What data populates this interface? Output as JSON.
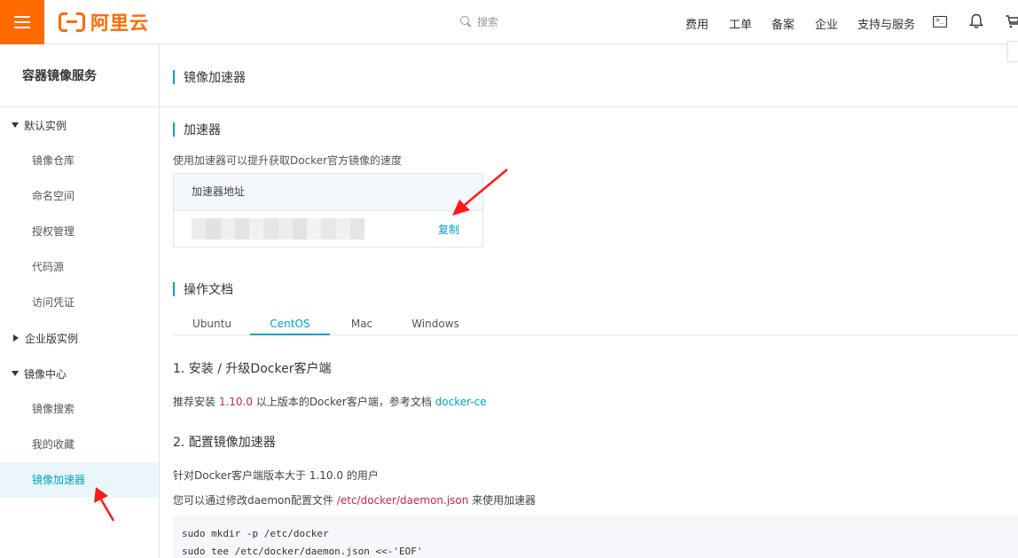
{
  "colors": {
    "brand": "#ff6a00",
    "accent": "#00a2ca",
    "arrow": "#ff1a1a",
    "code_red": "#c7254e"
  },
  "header": {
    "menu_icon": "hamburger-icon",
    "logo_text": "阿里云",
    "search_placeholder": "搜索",
    "nav": [
      "费用",
      "工单",
      "备案",
      "企业",
      "支持与服务"
    ],
    "icons": [
      "terminal-icon",
      "bell-icon",
      "cart-icon"
    ]
  },
  "sidebar": {
    "title": "容器镜像服务",
    "groups": [
      {
        "label": "默认实例",
        "expanded": true,
        "items": [
          "镜像仓库",
          "命名空间",
          "授权管理",
          "代码源",
          "访问凭证"
        ]
      },
      {
        "label": "企业版实例",
        "expanded": false,
        "items": []
      },
      {
        "label": "镜像中心",
        "expanded": true,
        "items": [
          "镜像搜索",
          "我的收藏",
          "镜像加速器"
        ]
      }
    ],
    "active_item": "镜像加速器"
  },
  "main": {
    "page_title": "镜像加速器",
    "accelerator": {
      "section_title": "加速器",
      "description": "使用加速器可以提升获取Docker官方镜像的速度",
      "box_header": "加速器地址",
      "copy_label": "复制"
    },
    "docs": {
      "section_title": "操作文档",
      "tabs": [
        "Ubuntu",
        "CentOS",
        "Mac",
        "Windows"
      ],
      "active_tab": "CentOS",
      "step1": {
        "title": "1. 安装 / 升级Docker客户端",
        "text_before": "推荐安装 ",
        "version": "1.10.0",
        "text_after": " 以上版本的Docker客户端，参考文档 ",
        "link": "docker-ce"
      },
      "step2": {
        "title": "2. 配置镜像加速器",
        "line1": "针对Docker客户端版本大于 1.10.0 的用户",
        "line2_before": "您可以通过修改daemon配置文件 ",
        "line2_path": "/etc/docker/daemon.json",
        "line2_after": " 来使用加速器",
        "code": [
          "sudo mkdir -p /etc/docker",
          "sudo tee /etc/docker/daemon.json <<-'EOF'"
        ]
      }
    }
  }
}
